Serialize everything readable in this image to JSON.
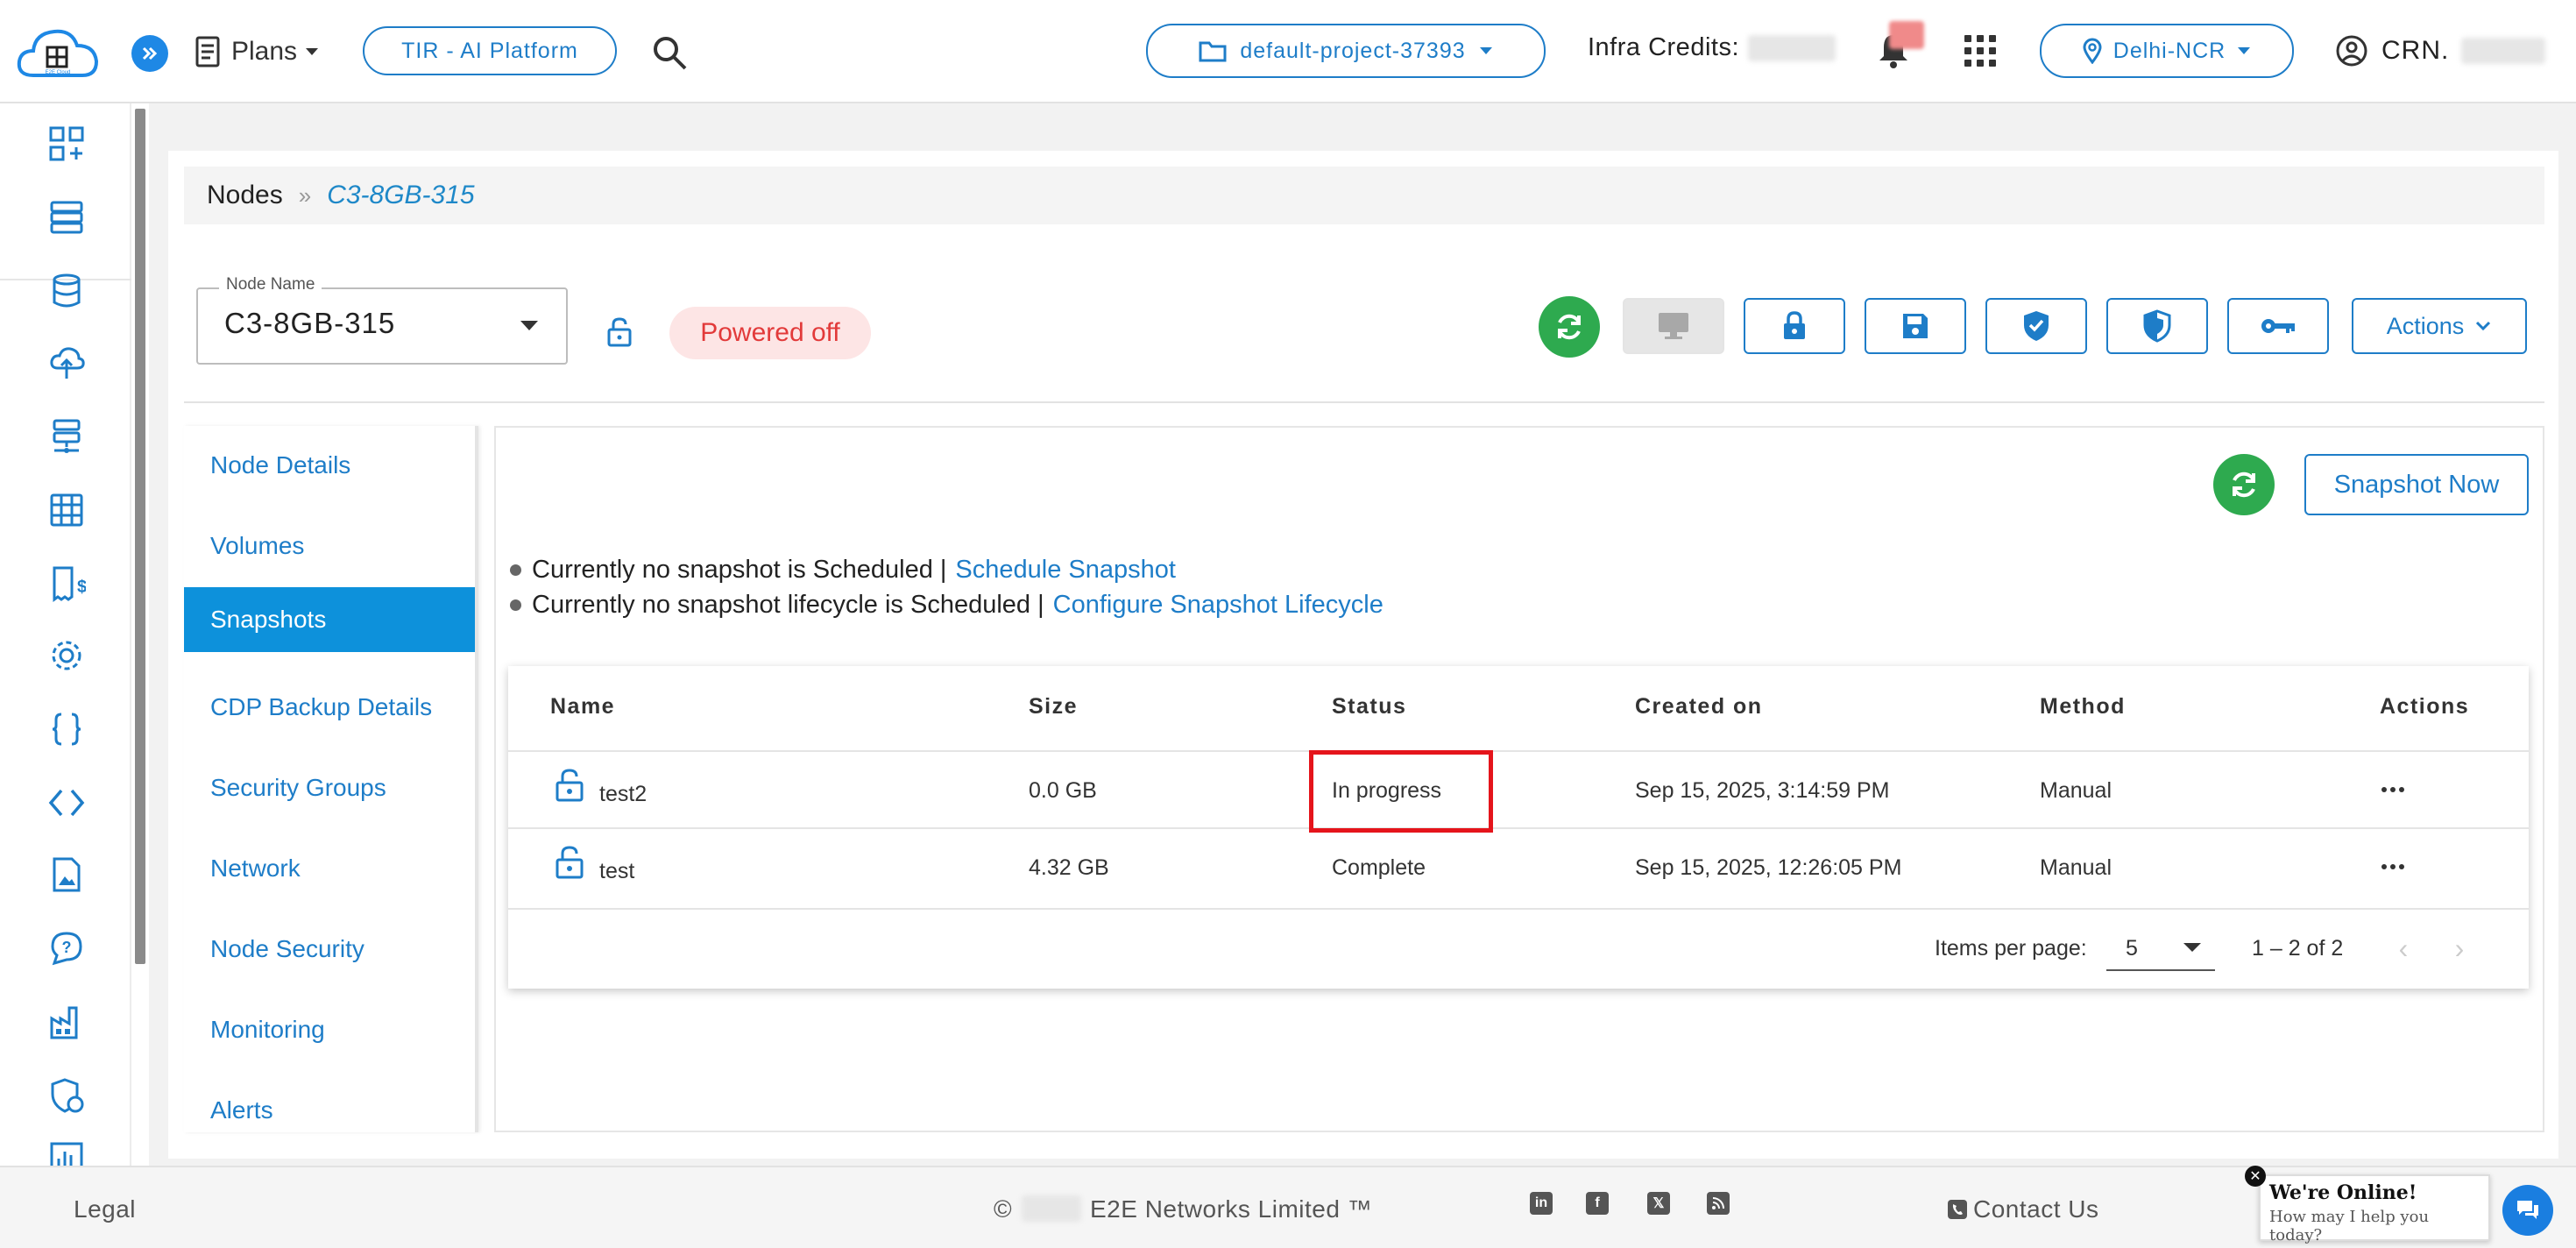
{
  "header": {
    "logo_text": "E2E Cloud",
    "plans_label": "Plans",
    "tir_label": "TIR - AI Platform",
    "project_label": "default-project-37393",
    "credits_label": "Infra Credits:",
    "region_label": "Delhi-NCR",
    "crn_label": "CRN.",
    "accent_color": "#1e7dc8"
  },
  "rail": {
    "icons": [
      "dashboard-add-icon",
      "server-icon",
      "database-icon",
      "cloud-upload-icon",
      "network-nodes-icon",
      "grid-table-icon",
      "billing-icon",
      "settings-icon",
      "braces-icon",
      "code-icon",
      "document-image-icon",
      "chat-help-icon",
      "factory-icon",
      "shield-lock-icon",
      "chart-icon"
    ]
  },
  "breadcrumb": {
    "root": "Nodes",
    "separator": "»",
    "current": "C3-8GB-315"
  },
  "node": {
    "field_label": "Node Name",
    "name": "C3-8GB-315",
    "status": "Powered off",
    "status_color": "#e23a3a"
  },
  "toolbar": {
    "actions_label": "Actions",
    "icons": [
      "refresh-icon",
      "monitor-icon",
      "lock-icon",
      "save-icon",
      "shield-check-icon",
      "shield-half-icon",
      "key-icon"
    ]
  },
  "nav": {
    "items": [
      {
        "label": "Node Details",
        "active": false
      },
      {
        "label": "Volumes",
        "active": false
      },
      {
        "label": "Snapshots",
        "active": true
      },
      {
        "label": "CDP Backup Details",
        "active": false
      },
      {
        "label": "Security Groups",
        "active": false
      },
      {
        "label": "Network",
        "active": false
      },
      {
        "label": "Node Security",
        "active": false
      },
      {
        "label": "Monitoring",
        "active": false
      },
      {
        "label": "Alerts",
        "active": false
      }
    ]
  },
  "snapshots": {
    "snapshot_now_label": "Snapshot Now",
    "info": [
      {
        "text": "Currently no snapshot is Scheduled |",
        "link": "Schedule Snapshot"
      },
      {
        "text": "Currently no snapshot lifecycle is Scheduled |",
        "link": "Configure Snapshot Lifecycle"
      }
    ],
    "columns": [
      "Name",
      "Size",
      "Status",
      "Created on",
      "Method",
      "Actions"
    ],
    "rows": [
      {
        "name": "test2",
        "size": "0.0 GB",
        "status": "In progress",
        "created": "Sep 15, 2025, 3:14:59 PM",
        "method": "Manual"
      },
      {
        "name": "test",
        "size": "4.32 GB",
        "status": "Complete",
        "created": "Sep 15, 2025, 12:26:05 PM",
        "method": "Manual"
      }
    ],
    "highlight_color": "#e5141b",
    "pager": {
      "label": "Items per page:",
      "per_page": "5",
      "range": "1 – 2 of 2"
    }
  },
  "footer": {
    "legal": "Legal",
    "copyright_symbol": "©",
    "company": "E2E Networks Limited ™",
    "social": [
      "linkedin-icon",
      "facebook-icon",
      "x-icon",
      "rss-icon"
    ],
    "contact": "Contact Us"
  },
  "chat": {
    "title": "We're Online!",
    "subtitle": "How may I help you today?"
  }
}
